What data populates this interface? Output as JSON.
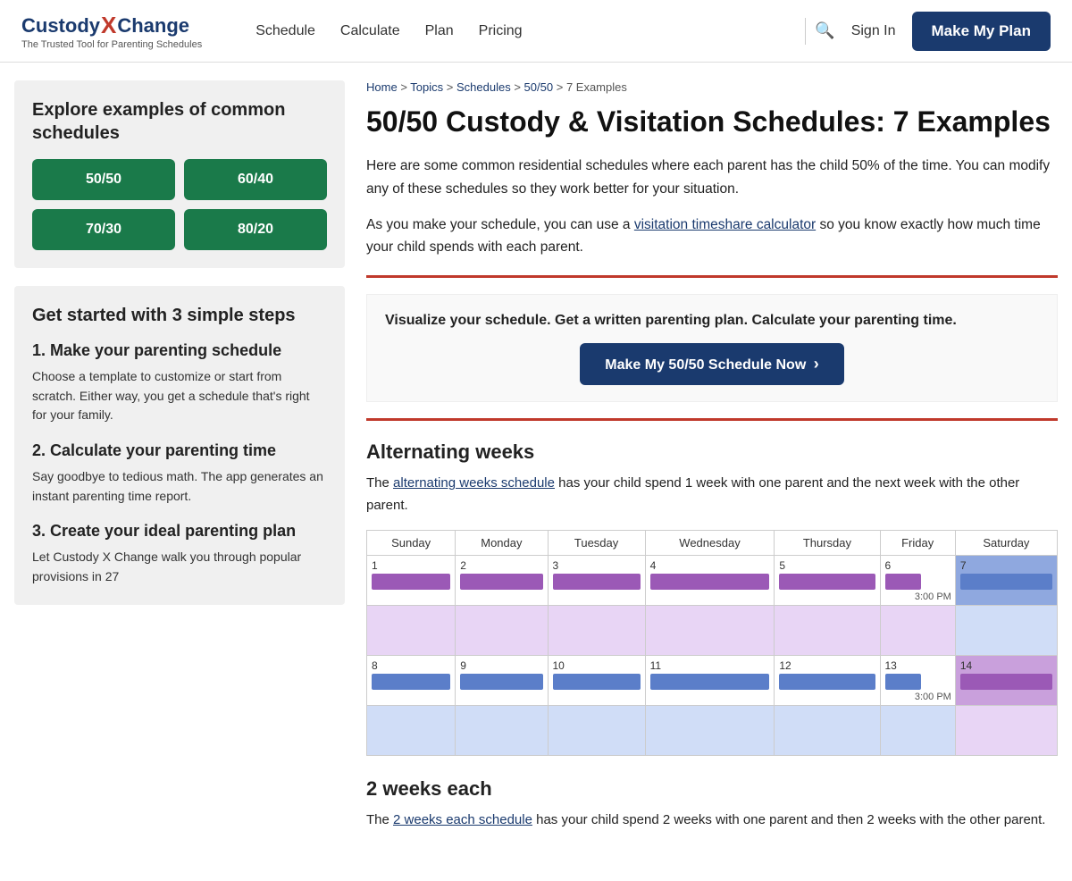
{
  "nav": {
    "logo_custody": "Custody",
    "logo_x": "X",
    "logo_change": "Change",
    "logo_sub": "The Trusted Tool for Parenting Schedules",
    "links": [
      "Schedule",
      "Calculate",
      "Plan",
      "Pricing"
    ],
    "sign_in": "Sign In",
    "cta": "Make My Plan",
    "search_icon": "🔍"
  },
  "sidebar": {
    "explore_title": "Explore examples of common schedules",
    "schedule_btns": [
      "50/50",
      "60/40",
      "70/30",
      "80/20"
    ],
    "steps_title": "Get started with 3 simple steps",
    "step1_title": "1. Make your parenting schedule",
    "step1_desc": "Choose a template to customize or start from scratch. Either way, you get a schedule that's right for your family.",
    "step2_title": "2. Calculate your parenting time",
    "step2_desc": "Say goodbye to tedious math. The app generates an instant parenting time report.",
    "step3_title": "3. Create your ideal parenting plan",
    "step3_desc": "Let Custody X Change walk you through popular provisions in 27"
  },
  "breadcrumb": {
    "home": "Home",
    "sep1": " > ",
    "topics": "Topics",
    "sep2": " > ",
    "schedules": "Schedules",
    "sep3": " > ",
    "fiftyfifty": "50/50",
    "sep4": " > ",
    "current": "7 Examples"
  },
  "main": {
    "title": "50/50 Custody & Visitation Schedules: 7 Examples",
    "intro1": "Here are some common residential schedules where each parent has the child 50% of the time. You can modify any of these schedules so they work better for your situation.",
    "intro2_pre": "As you make your schedule, you can use a ",
    "intro2_link": "visitation timeshare calculator",
    "intro2_post": " so you know exactly how much time your child spends with each parent.",
    "cta_text": "Visualize your schedule. Get a written parenting plan. Calculate your parenting time.",
    "cta_btn": "Make My 50/50 Schedule Now",
    "section1_title": "Alternating weeks",
    "section1_pre": "The ",
    "section1_link": "alternating weeks schedule",
    "section1_post": " has your child spend 1 week with one parent and the next week with the other parent.",
    "cal_days": [
      "Sunday",
      "Monday",
      "Tuesday",
      "Wednesday",
      "Thursday",
      "Friday",
      "Saturday"
    ],
    "cal_row1": [
      "1",
      "2",
      "3",
      "4",
      "5",
      "6",
      "7"
    ],
    "cal_row2": [
      "8",
      "9",
      "10",
      "11",
      "12",
      "13",
      "14"
    ],
    "cal_time1": "3:00 PM",
    "cal_time2": "3:00 PM",
    "section2_title": "2 weeks each",
    "section2_pre": "The ",
    "section2_link": "2 weeks each schedule",
    "section2_post": " has your child spend 2 weeks with one parent and then 2 weeks with the other parent."
  }
}
